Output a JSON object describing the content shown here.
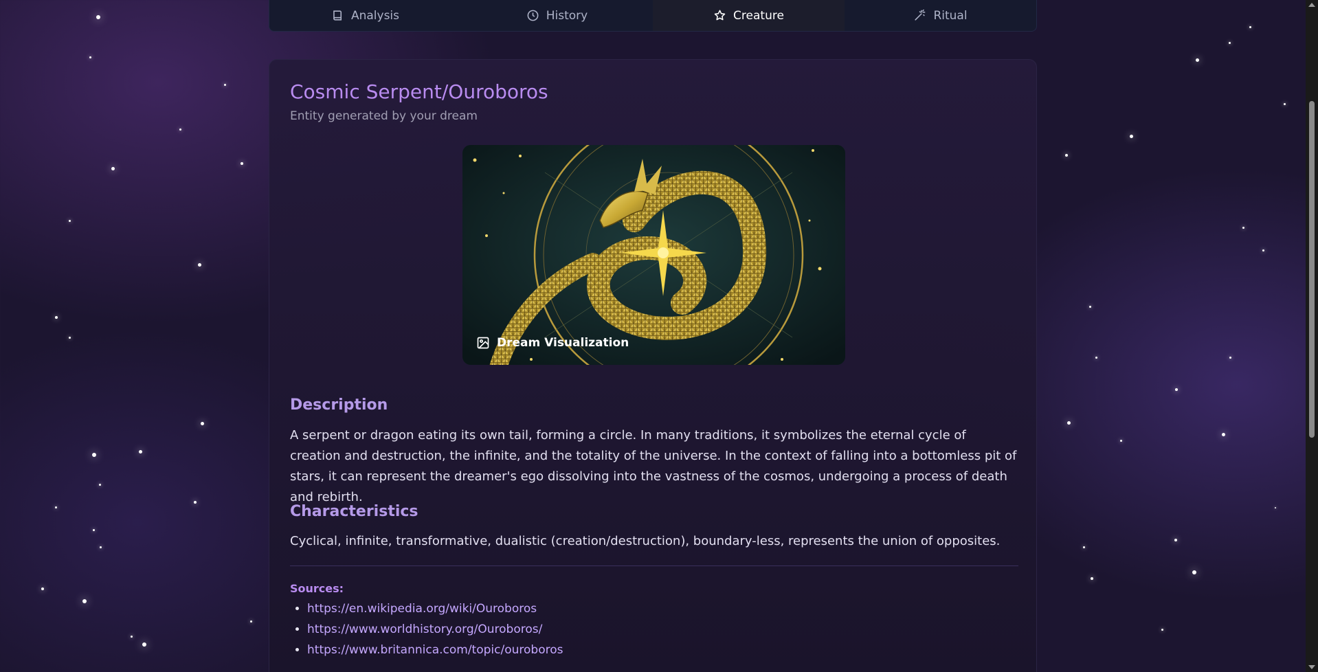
{
  "tabs": [
    {
      "label": "Analysis",
      "icon": "book-icon",
      "active": false
    },
    {
      "label": "History",
      "icon": "clock-icon",
      "active": false
    },
    {
      "label": "Creature",
      "icon": "star-icon",
      "active": true
    },
    {
      "label": "Ritual",
      "icon": "magic-wand-icon",
      "active": false
    }
  ],
  "entity": {
    "title": "Cosmic Serpent/Ouroboros",
    "subtitle": "Entity generated by your dream",
    "image_label": "Dream Visualization",
    "description_heading": "Description",
    "description": "A serpent or dragon eating its own tail, forming a circle. In many traditions, it symbolizes the eternal cycle of creation and destruction, the infinite, and the totality of the universe. In the context of falling into a bottomless pit of stars, it can represent the dreamer's ego dissolving into the vastness of the cosmos, undergoing a process of death and rebirth.",
    "characteristics_heading": "Characteristics",
    "characteristics": "Cyclical, infinite, transformative, dualistic (creation/destruction), boundary-less, represents the union of opposites.",
    "sources_label": "Sources:",
    "sources": [
      "https://en.wikipedia.org/wiki/Ouroboros",
      "https://www.worldhistory.org/Ouroboros/",
      "https://www.britannica.com/topic/ouroboros"
    ]
  },
  "colors": {
    "accent_title": "#b98cf0",
    "heading": "#b59ae8",
    "link": "#c5a8ff",
    "background": "#1c1530",
    "gold": "#c9a935"
  }
}
